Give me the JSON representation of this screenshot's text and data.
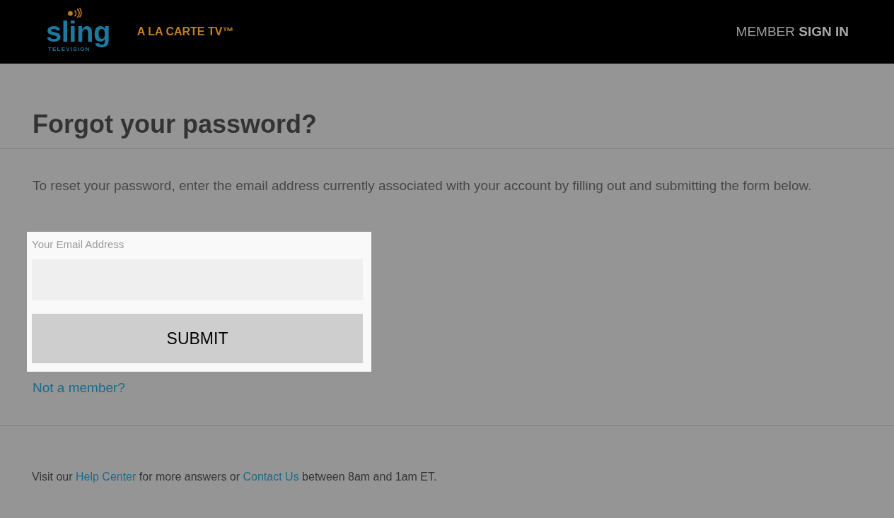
{
  "header": {
    "logo": {
      "wordmark": "sling",
      "subtitle": "TELEVISION"
    },
    "tagline": "A LA CARTE TV™",
    "sign_in_link": "MEMBER **SIGN IN**"
  },
  "page": {
    "title": "Forgot your password?",
    "instructions": "To reset your password, enter the email address currently associated with your account by filling out and submitting the form below."
  },
  "form": {
    "email_field": {
      "label": "Your Email Address"
    },
    "submit_button": "SUBMIT"
  },
  "not_member_link": "Not a member?",
  "footer": {
    "parts": [
      {
        "kind": "text",
        "text": "Visit our"
      },
      {
        "kind": "link",
        "text": "Help Center"
      },
      {
        "kind": "text",
        "text": "for more answers or"
      },
      {
        "kind": "link",
        "text": "Contact Us"
      },
      {
        "kind": "text",
        "text": "between 8am and 1am ET."
      }
    ]
  }
}
